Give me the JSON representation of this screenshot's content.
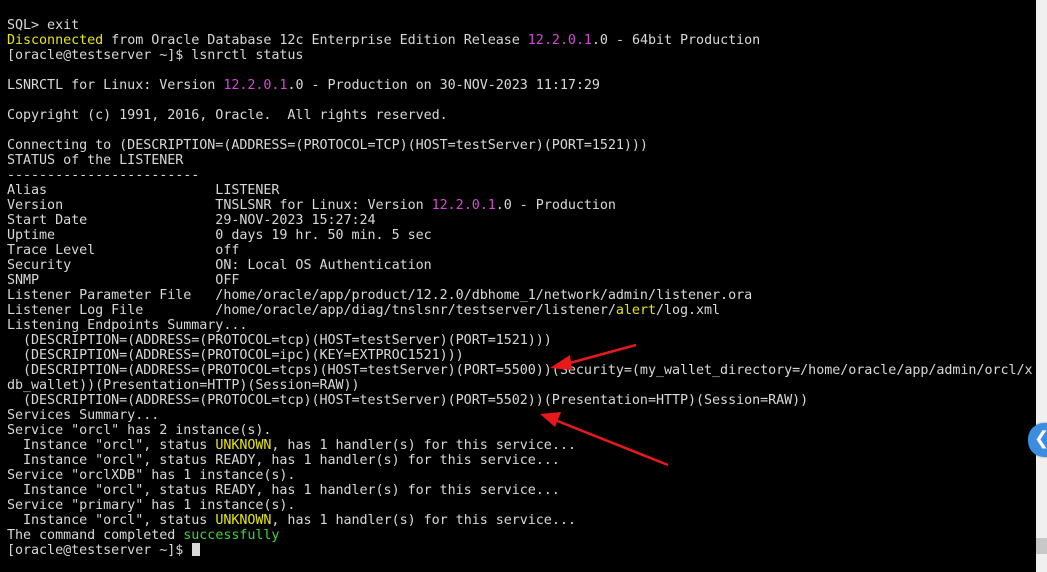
{
  "terminal": {
    "lines": [
      [
        {
          "t": "SQL> exit"
        }
      ],
      [
        {
          "t": "Disconnected",
          "c": "yellow"
        },
        {
          "t": " from Oracle Database 12c Enterprise Edition Release "
        },
        {
          "t": "12.2.0.1",
          "c": "magenta"
        },
        {
          "t": ".0 - 64bit Production"
        }
      ],
      [
        {
          "t": "[oracle@testserver ~]$ lsnrctl status"
        }
      ],
      [],
      [
        {
          "t": "LSNRCTL for Linux: Version "
        },
        {
          "t": "12.2.0.1",
          "c": "magenta"
        },
        {
          "t": ".0 - Production on 30-NOV-2023 11:17:29"
        }
      ],
      [],
      [
        {
          "t": "Copyright (c) 1991, 2016, Oracle.  All rights reserved."
        }
      ],
      [],
      [
        {
          "t": "Connecting to (DESCRIPTION=(ADDRESS=(PROTOCOL=TCP)(HOST=testServer)(PORT=1521)))"
        }
      ],
      [
        {
          "t": "STATUS of the LISTENER"
        }
      ],
      [
        {
          "t": "------------------------"
        }
      ],
      [
        {
          "t": "Alias                     LISTENER"
        }
      ],
      [
        {
          "t": "Version                   TNSLSNR for Linux: Version "
        },
        {
          "t": "12.2.0.1",
          "c": "magenta"
        },
        {
          "t": ".0 - Production"
        }
      ],
      [
        {
          "t": "Start Date                29-NOV-2023 15:27:24"
        }
      ],
      [
        {
          "t": "Uptime                    0 days 19 hr. 50 min. 5 sec"
        }
      ],
      [
        {
          "t": "Trace Level               off"
        }
      ],
      [
        {
          "t": "Security                  ON: Local OS Authentication"
        }
      ],
      [
        {
          "t": "SNMP                      OFF"
        }
      ],
      [
        {
          "t": "Listener Parameter File   /home/oracle/app/product/12.2.0/dbhome_1/network/admin/listener.ora"
        }
      ],
      [
        {
          "t": "Listener Log File         /home/oracle/app/diag/tnslsnr/testserver/listener/"
        },
        {
          "t": "alert",
          "c": "yellow"
        },
        {
          "t": "/log.xml"
        }
      ],
      [
        {
          "t": "Listening Endpoints Summary..."
        }
      ],
      [
        {
          "t": "  (DESCRIPTION=(ADDRESS=(PROTOCOL=tcp)(HOST=testServer)(PORT=1521)))"
        }
      ],
      [
        {
          "t": "  (DESCRIPTION=(ADDRESS=(PROTOCOL=ipc)(KEY=EXTPROC1521)))"
        }
      ],
      [
        {
          "t": "  (DESCRIPTION=(ADDRESS=(PROTOCOL=tcps)(HOST=testServer)(PORT=5500))(Security=(my_wallet_directory=/home/oracle/app/admin/orcl/x"
        }
      ],
      [
        {
          "t": "db_wallet))(Presentation=HTTP)(Session=RAW))"
        }
      ],
      [
        {
          "t": "  (DESCRIPTION=(ADDRESS=(PROTOCOL=tcp)(HOST=testServer)(PORT=5502))(Presentation=HTTP)(Session=RAW))"
        }
      ],
      [
        {
          "t": "Services Summary..."
        }
      ],
      [
        {
          "t": "Service \"orcl\" has 2 instance(s)."
        }
      ],
      [
        {
          "t": "  Instance \"orcl\", status "
        },
        {
          "t": "UNKNOWN",
          "c": "yellow"
        },
        {
          "t": ", has 1 handler(s) for this service..."
        }
      ],
      [
        {
          "t": "  Instance \"orcl\", status READY, has 1 handler(s) for this service..."
        }
      ],
      [
        {
          "t": "Service \"orclXDB\" has 1 instance(s)."
        }
      ],
      [
        {
          "t": "  Instance \"orcl\", status READY, has 1 handler(s) for this service..."
        }
      ],
      [
        {
          "t": "Service \"primary\" has 1 instance(s)."
        }
      ],
      [
        {
          "t": "  Instance \"orcl\", status "
        },
        {
          "t": "UNKNOWN",
          "c": "yellow"
        },
        {
          "t": ", has 1 handler(s) for this service..."
        }
      ],
      [
        {
          "t": "The command completed "
        },
        {
          "t": "successfully",
          "c": "green"
        }
      ],
      [
        {
          "t": "[oracle@testserver ~]$ "
        }
      ]
    ]
  },
  "side_tab": {
    "icon": "chevron-left-icon",
    "glyph": "❮"
  },
  "colors": {
    "background": "#000000",
    "text": "#d8d8d8",
    "yellow": "#e5e510",
    "magenta": "#d548d5",
    "green": "#3ad63a",
    "annotation_arrow": "#e8191b",
    "side_tab": "#3b8de0"
  }
}
